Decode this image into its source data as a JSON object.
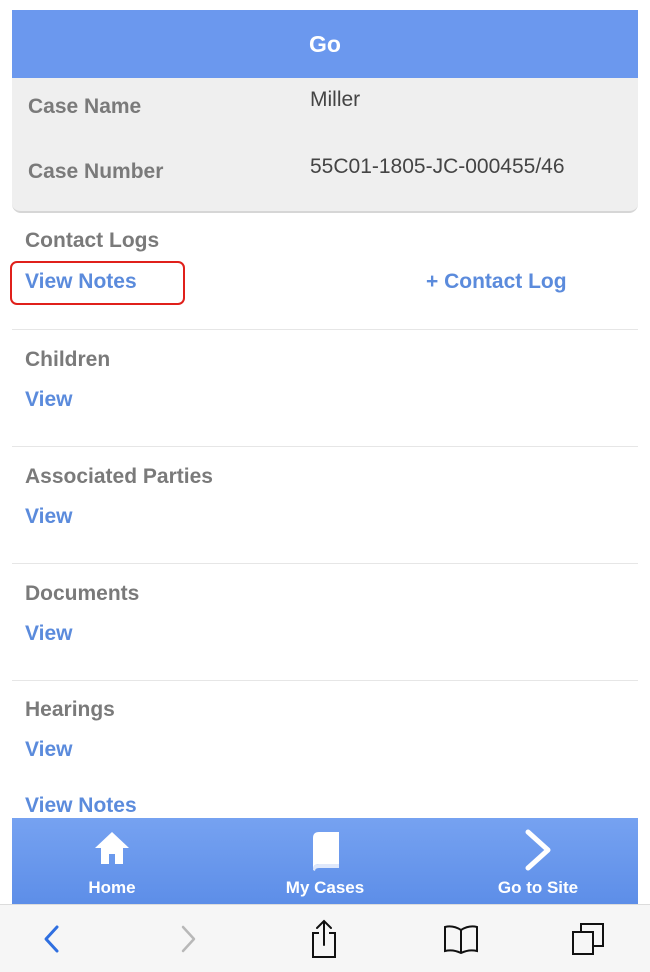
{
  "header": {
    "title": "Go"
  },
  "case_info": {
    "name_label": "Case Name",
    "name_value": "Miller",
    "number_label": "Case Number",
    "number_value": "55C01-1805-JC-000455/46"
  },
  "sections": [
    {
      "title": "Contact Logs",
      "link": "View Notes",
      "secondary_link": "+ Contact Log"
    },
    {
      "title": "Children",
      "link": "View"
    },
    {
      "title": "Associated Parties",
      "link": "View"
    },
    {
      "title": "Documents",
      "link": "View"
    },
    {
      "title": "Hearings",
      "link": "View"
    }
  ],
  "extra_link": "View Notes",
  "tabbar": {
    "items": [
      {
        "label": "Home",
        "icon": "home-icon"
      },
      {
        "label": "My Cases",
        "icon": "book-icon"
      },
      {
        "label": "Go to Site",
        "icon": "chevron-right-icon"
      }
    ]
  },
  "browser_toolbar": {
    "items": [
      "back-icon",
      "forward-icon",
      "share-icon",
      "bookmarks-icon",
      "tabs-icon"
    ]
  },
  "colors": {
    "header_bg": "#6b98ee",
    "link": "#5b8bdc",
    "highlight": "#e0201b"
  }
}
